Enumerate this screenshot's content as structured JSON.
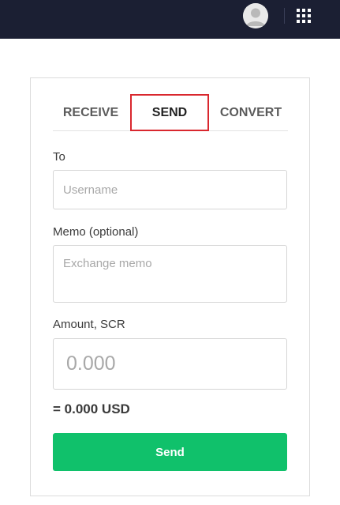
{
  "header": {
    "avatar_icon": "user-avatar-icon",
    "apps_icon": "grid-apps-icon",
    "background": "#1b1f33"
  },
  "tabs": [
    {
      "label": "RECEIVE",
      "active": false
    },
    {
      "label": "SEND",
      "active": true
    },
    {
      "label": "CONVERT",
      "active": false
    }
  ],
  "form": {
    "to_label": "To",
    "to_placeholder": "Username",
    "memo_label": "Memo (optional)",
    "memo_placeholder": "Exchange memo",
    "amount_label": "Amount, SCR",
    "amount_placeholder": "0.000",
    "usd_value": "= 0.000 USD",
    "send_label": "Send"
  },
  "colors": {
    "accent_green": "#10c16b",
    "active_tab_border": "#d9272e"
  }
}
